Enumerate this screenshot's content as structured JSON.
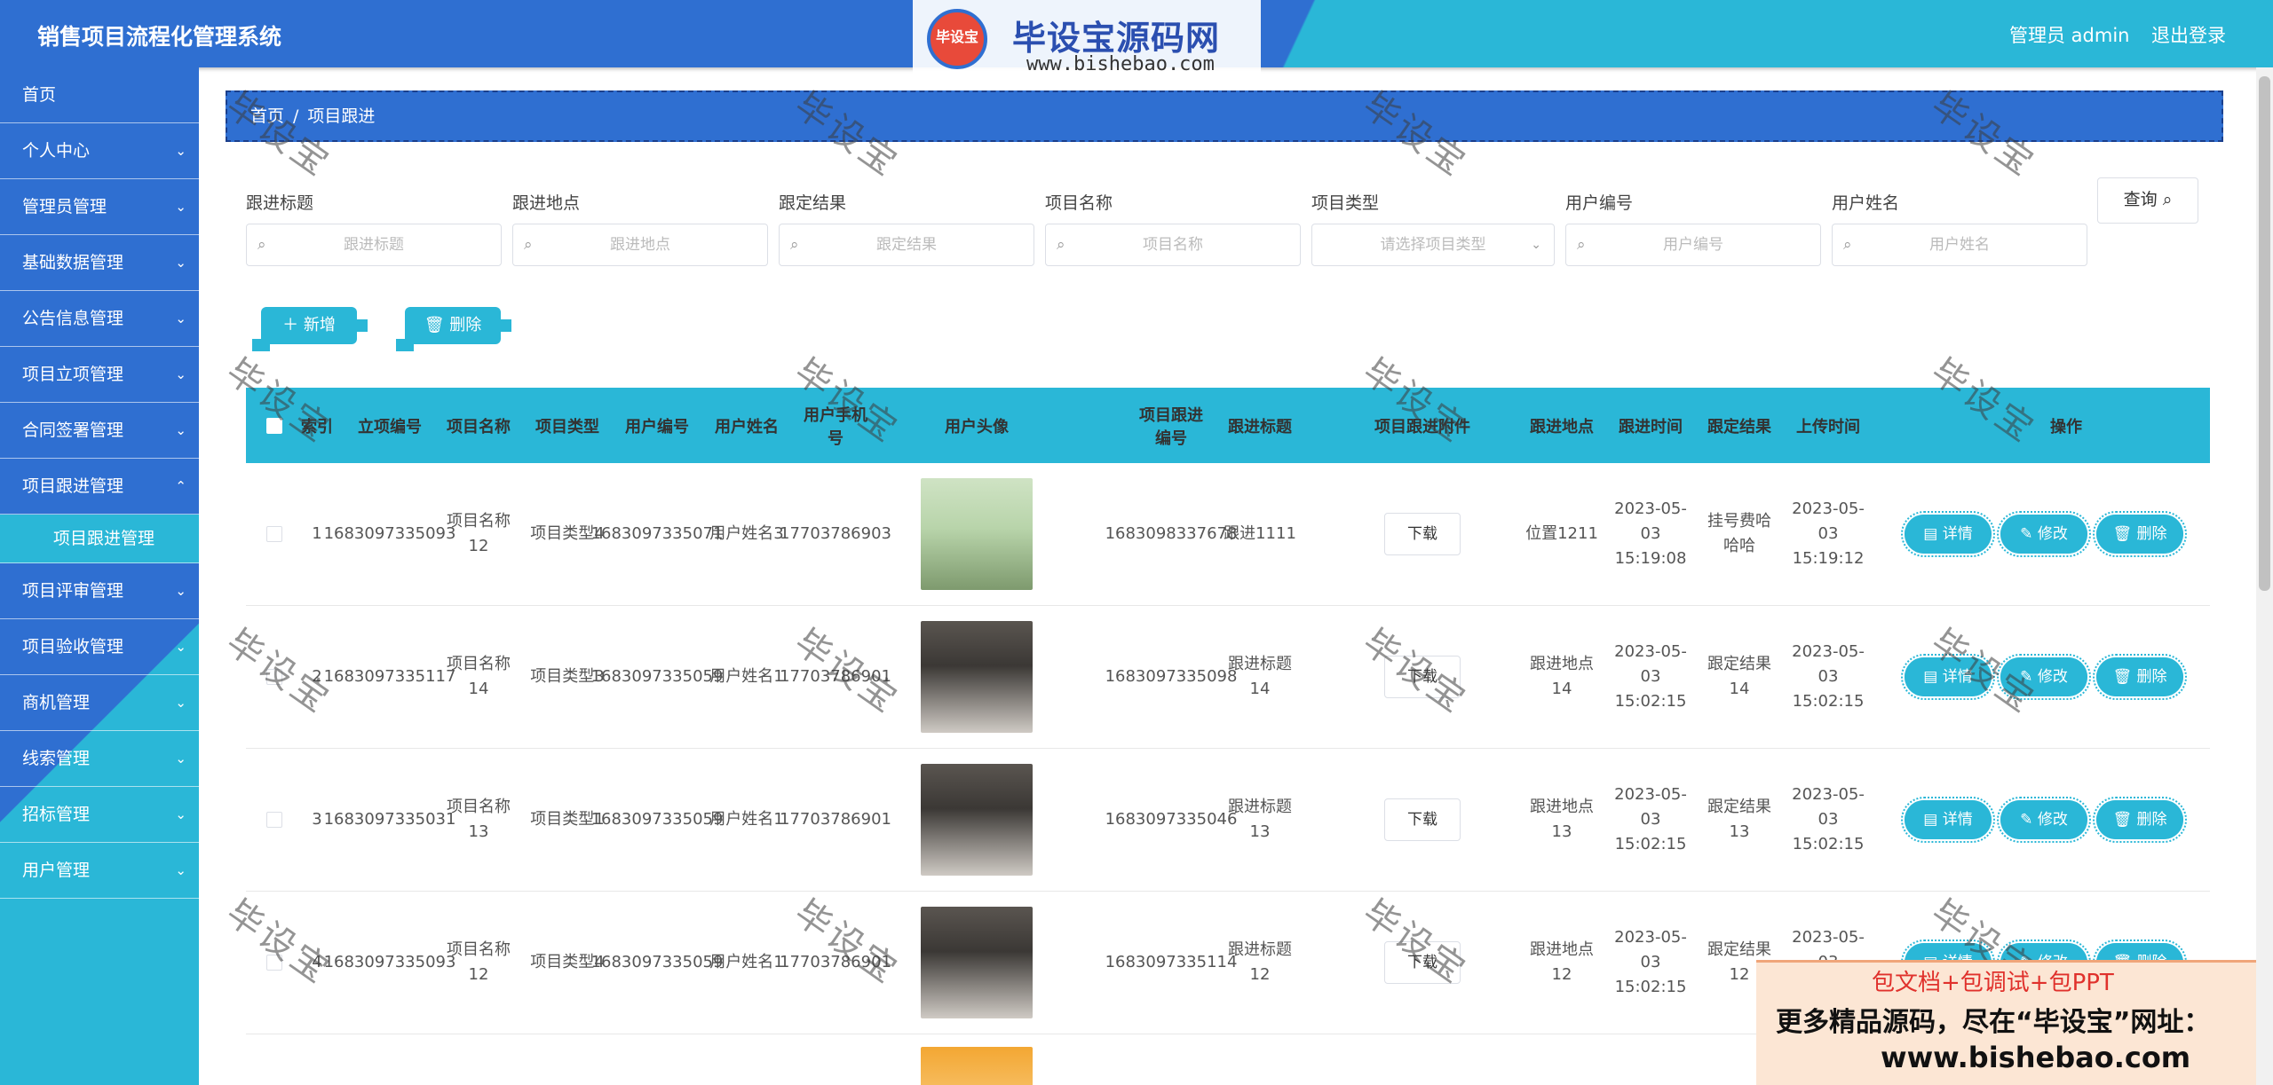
{
  "header": {
    "title": "销售项目流程化管理系统",
    "admin": "管理员 admin",
    "logout": "退出登录"
  },
  "banner": {
    "badge": "毕设宝",
    "brand": "毕设宝源码网",
    "url": "www.bishebao.com"
  },
  "sidebar": {
    "items": [
      {
        "label": "首页",
        "chev": ""
      },
      {
        "label": "个人中心",
        "chev": "⌄"
      },
      {
        "label": "管理员管理",
        "chev": "⌄"
      },
      {
        "label": "基础数据管理",
        "chev": "⌄"
      },
      {
        "label": "公告信息管理",
        "chev": "⌄"
      },
      {
        "label": "项目立项管理",
        "chev": "⌄"
      },
      {
        "label": "合同签署管理",
        "chev": "⌄"
      },
      {
        "label": "项目跟进管理",
        "chev": "⌃"
      },
      {
        "label": "项目跟进管理",
        "chev": ""
      },
      {
        "label": "项目评审管理",
        "chev": "⌄"
      },
      {
        "label": "项目验收管理",
        "chev": "⌄"
      },
      {
        "label": "商机管理",
        "chev": "⌄"
      },
      {
        "label": "线索管理",
        "chev": "⌄"
      },
      {
        "label": "招标管理",
        "chev": "⌄"
      },
      {
        "label": "用户管理",
        "chev": "⌄"
      }
    ]
  },
  "breadcrumb": {
    "home": "首页",
    "sep": "/",
    "current": "项目跟进"
  },
  "search": {
    "fields": [
      {
        "label": "跟进标题",
        "placeholder": "跟进标题"
      },
      {
        "label": "跟进地点",
        "placeholder": "跟进地点"
      },
      {
        "label": "跟定结果",
        "placeholder": "跟定结果"
      },
      {
        "label": "项目名称",
        "placeholder": "项目名称"
      },
      {
        "label": "项目类型",
        "placeholder": "请选择项目类型"
      },
      {
        "label": "用户编号",
        "placeholder": "用户编号"
      },
      {
        "label": "用户姓名",
        "placeholder": "用户姓名"
      }
    ],
    "query_button": "查询 ⌕"
  },
  "actions": {
    "add": "＋ 新增",
    "delete": "🗑 删除"
  },
  "table": {
    "headers": [
      "索引",
      "立项编号",
      "项目名称",
      "项目类型",
      "用户编号",
      "用户姓名",
      "用户手机号",
      "用户头像",
      "项目跟进编号",
      "跟进标题",
      "项目跟进附件",
      "跟进地点",
      "跟进时间",
      "跟定结果",
      "上传时间",
      "操作"
    ],
    "rows": [
      {
        "idx": "1",
        "lixiang": "1683097335093",
        "name": "项目名称12",
        "type": "项目类型4",
        "uid": "1683097335071",
        "uname": "用户姓名3",
        "phone": "17703786903",
        "gid": "1683098337678",
        "gtitle": "跟进1111",
        "file": "下载",
        "place": "位置1211",
        "gtime": "2023-05-03 15:19:08",
        "result": "挂号费哈哈哈",
        "utime": "2023-05-03 15:19:12"
      },
      {
        "idx": "2",
        "lixiang": "1683097335117",
        "name": "项目名称14",
        "type": "项目类型3",
        "uid": "1683097335059",
        "uname": "用户姓名1",
        "phone": "17703786901",
        "gid": "1683097335098",
        "gtitle": "跟进标题14",
        "file": "下载",
        "place": "跟进地点14",
        "gtime": "2023-05-03 15:02:15",
        "result": "跟定结果14",
        "utime": "2023-05-03 15:02:15"
      },
      {
        "idx": "3",
        "lixiang": "1683097335031",
        "name": "项目名称13",
        "type": "项目类型1",
        "uid": "1683097335059",
        "uname": "用户姓名1",
        "phone": "17703786901",
        "gid": "1683097335046",
        "gtitle": "跟进标题13",
        "file": "下载",
        "place": "跟进地点13",
        "gtime": "2023-05-03 15:02:15",
        "result": "跟定结果13",
        "utime": "2023-05-03 15:02:15"
      },
      {
        "idx": "4",
        "lixiang": "1683097335093",
        "name": "项目名称12",
        "type": "项目类型4",
        "uid": "1683097335059",
        "uname": "用户姓名1",
        "phone": "17703786901",
        "gid": "1683097335114",
        "gtitle": "跟进标题12",
        "file": "下载",
        "place": "跟进地点12",
        "gtime": "2023-05-03 15:02:15",
        "result": "跟定结果12",
        "utime": "2023-05-03 15:02:15"
      }
    ],
    "ops": {
      "detail": "▤ 详情",
      "edit": "✎ 修改",
      "del": "🗑 删除"
    }
  },
  "watermark": "毕设宝",
  "promo": {
    "line1": "包文档+包调试+包PPT",
    "line2": "更多精品源码，尽在“毕设宝”网址：",
    "line3": "www.bishebao.com"
  },
  "colors": {
    "primary": "#2f6fd1",
    "accent": "#2ab7d7"
  }
}
